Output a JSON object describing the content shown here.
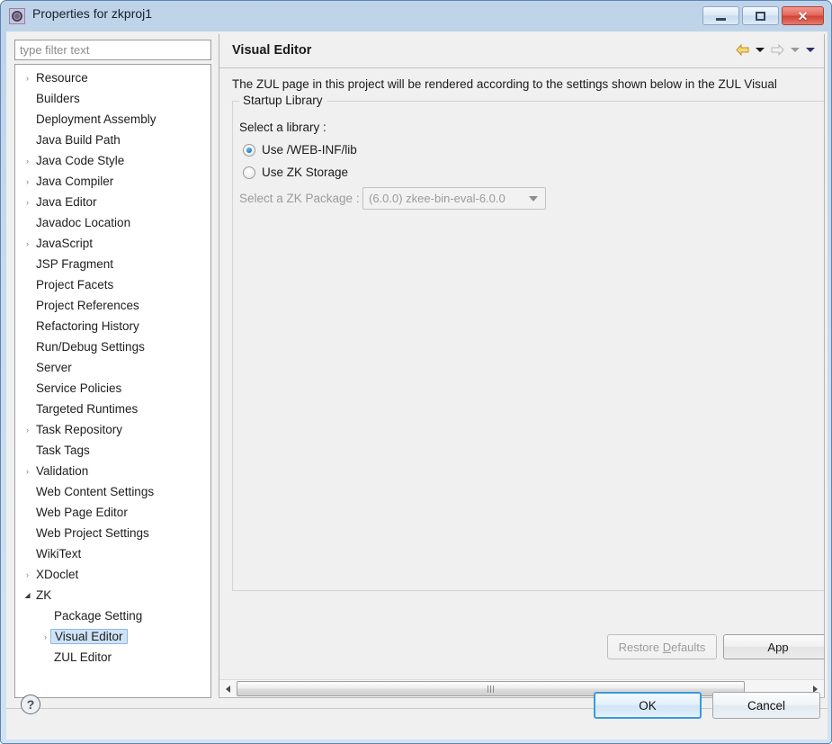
{
  "window": {
    "title": "Properties for zkproj1",
    "icon": "properties-gear-icon",
    "minimize_label": "Minimize",
    "maximize_label": "Maximize",
    "close_label": "✕"
  },
  "filter": {
    "placeholder": "type filter text",
    "value": ""
  },
  "tree": {
    "items": [
      {
        "label": "Resource",
        "arrow": "collapsed",
        "indent": 0,
        "selected": false
      },
      {
        "label": "Builders",
        "arrow": "none",
        "indent": 0,
        "selected": false
      },
      {
        "label": "Deployment Assembly",
        "arrow": "none",
        "indent": 0,
        "selected": false
      },
      {
        "label": "Java Build Path",
        "arrow": "none",
        "indent": 0,
        "selected": false
      },
      {
        "label": "Java Code Style",
        "arrow": "collapsed",
        "indent": 0,
        "selected": false
      },
      {
        "label": "Java Compiler",
        "arrow": "collapsed",
        "indent": 0,
        "selected": false
      },
      {
        "label": "Java Editor",
        "arrow": "collapsed",
        "indent": 0,
        "selected": false
      },
      {
        "label": "Javadoc Location",
        "arrow": "none",
        "indent": 0,
        "selected": false
      },
      {
        "label": "JavaScript",
        "arrow": "collapsed",
        "indent": 0,
        "selected": false
      },
      {
        "label": "JSP Fragment",
        "arrow": "none",
        "indent": 0,
        "selected": false
      },
      {
        "label": "Project Facets",
        "arrow": "none",
        "indent": 0,
        "selected": false
      },
      {
        "label": "Project References",
        "arrow": "none",
        "indent": 0,
        "selected": false
      },
      {
        "label": "Refactoring History",
        "arrow": "none",
        "indent": 0,
        "selected": false
      },
      {
        "label": "Run/Debug Settings",
        "arrow": "none",
        "indent": 0,
        "selected": false
      },
      {
        "label": "Server",
        "arrow": "none",
        "indent": 0,
        "selected": false
      },
      {
        "label": "Service Policies",
        "arrow": "none",
        "indent": 0,
        "selected": false
      },
      {
        "label": "Targeted Runtimes",
        "arrow": "none",
        "indent": 0,
        "selected": false
      },
      {
        "label": "Task Repository",
        "arrow": "collapsed",
        "indent": 0,
        "selected": false
      },
      {
        "label": "Task Tags",
        "arrow": "none",
        "indent": 0,
        "selected": false
      },
      {
        "label": "Validation",
        "arrow": "collapsed",
        "indent": 0,
        "selected": false
      },
      {
        "label": "Web Content Settings",
        "arrow": "none",
        "indent": 0,
        "selected": false
      },
      {
        "label": "Web Page Editor",
        "arrow": "none",
        "indent": 0,
        "selected": false
      },
      {
        "label": "Web Project Settings",
        "arrow": "none",
        "indent": 0,
        "selected": false
      },
      {
        "label": "WikiText",
        "arrow": "none",
        "indent": 0,
        "selected": false
      },
      {
        "label": "XDoclet",
        "arrow": "collapsed",
        "indent": 0,
        "selected": false
      },
      {
        "label": "ZK",
        "arrow": "expanded",
        "indent": 0,
        "selected": false
      },
      {
        "label": "Package Setting",
        "arrow": "none",
        "indent": 1,
        "selected": false
      },
      {
        "label": "Visual Editor",
        "arrow": "collapsed",
        "indent": 1,
        "selected": true
      },
      {
        "label": "ZUL Editor",
        "arrow": "none",
        "indent": 1,
        "selected": false
      }
    ]
  },
  "content": {
    "title": "Visual Editor",
    "description": "The ZUL page in this project will be rendered according to the settings shown below in the ZUL Visual",
    "nav": {
      "back_icon": "back-arrow-icon",
      "back_menu_icon": "chevron-down-icon",
      "forward_icon": "forward-arrow-icon",
      "forward_menu_icon": "chevron-down-icon",
      "view_menu_icon": "chevron-down-icon"
    },
    "group": {
      "title": "Startup Library",
      "field_label": "Select a library :",
      "radios": [
        {
          "label": "Use /WEB-INF/lib",
          "selected": true
        },
        {
          "label": "Use ZK Storage",
          "selected": false
        }
      ],
      "package_label": "Select a ZK Package :",
      "package_value": "(6.0.0)  zkee-bin-eval-6.0.0",
      "package_disabled": true
    },
    "buttons": {
      "restore_defaults": "Restore Defaults",
      "restore_defaults_mnemonic": "D",
      "apply": "App"
    }
  },
  "footer": {
    "help_icon_label": "?",
    "ok_label": "OK",
    "cancel_label": "Cancel"
  },
  "colors": {
    "accent": "#3c9ada",
    "titlebar_start": "#bed3e8",
    "selection": "#cfe3f7",
    "radio_dot": "#1a7bc4",
    "disabled_text": "#9b9b9b"
  }
}
